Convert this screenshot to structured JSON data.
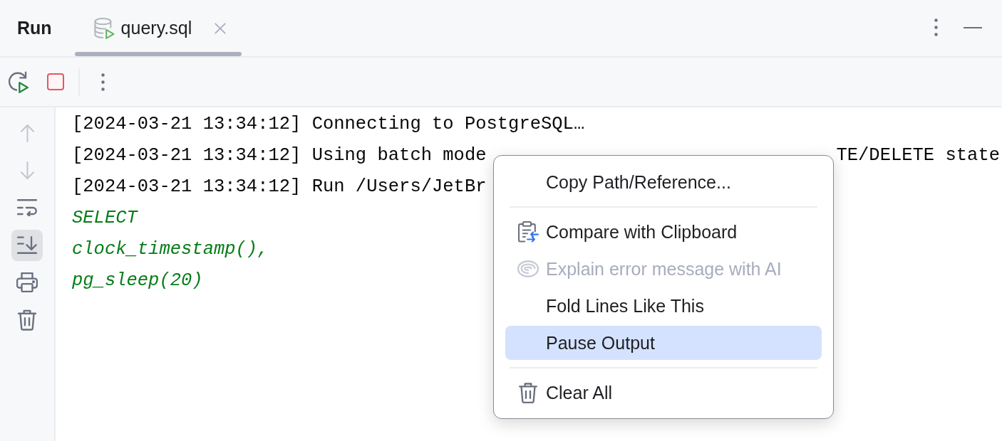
{
  "header": {
    "title": "Run",
    "tabs": [
      {
        "label": "query.sql",
        "selected": true
      }
    ]
  },
  "gutter": {
    "buttons": [
      {
        "kind": "up",
        "disabled": true,
        "on": false
      },
      {
        "kind": "down",
        "disabled": true,
        "on": false
      },
      {
        "kind": "wrap",
        "disabled": false,
        "on": false
      },
      {
        "kind": "scroll",
        "disabled": false,
        "on": true
      },
      {
        "kind": "print",
        "disabled": false,
        "on": false
      },
      {
        "kind": "clear",
        "disabled": false,
        "on": false
      }
    ]
  },
  "console": {
    "lines": [
      {
        "kind": "log",
        "text": "[2024-03-21 13:34:12] Connecting to PostgreSQL…"
      },
      {
        "kind": "log",
        "text": "[2024-03-21 13:34:12] Using batch mode",
        "tail": "TE/DELETE state"
      },
      {
        "kind": "log",
        "text": "[2024-03-21 13:34:12] Run /Users/JetBr"
      },
      {
        "kind": "sql",
        "text": "SELECT"
      },
      {
        "kind": "sql",
        "text": "clock_timestamp(),"
      },
      {
        "kind": "sql",
        "text": "pg_sleep(20)"
      }
    ]
  },
  "context_menu": {
    "items": [
      {
        "kind": "plain",
        "label": "Copy Path/Reference...",
        "disabled": false,
        "selected": false
      },
      {
        "kind": "separator"
      },
      {
        "kind": "compare",
        "label": "Compare with Clipboard",
        "disabled": false,
        "selected": false
      },
      {
        "kind": "ai",
        "label": "Explain error message with AI",
        "disabled": true,
        "selected": false
      },
      {
        "kind": "plain",
        "label": "Fold Lines Like This",
        "disabled": false,
        "selected": false
      },
      {
        "kind": "plain",
        "label": "Pause Output",
        "disabled": false,
        "selected": true
      },
      {
        "kind": "separator"
      },
      {
        "kind": "clear",
        "label": "Clear All",
        "disabled": false,
        "selected": false
      }
    ]
  }
}
